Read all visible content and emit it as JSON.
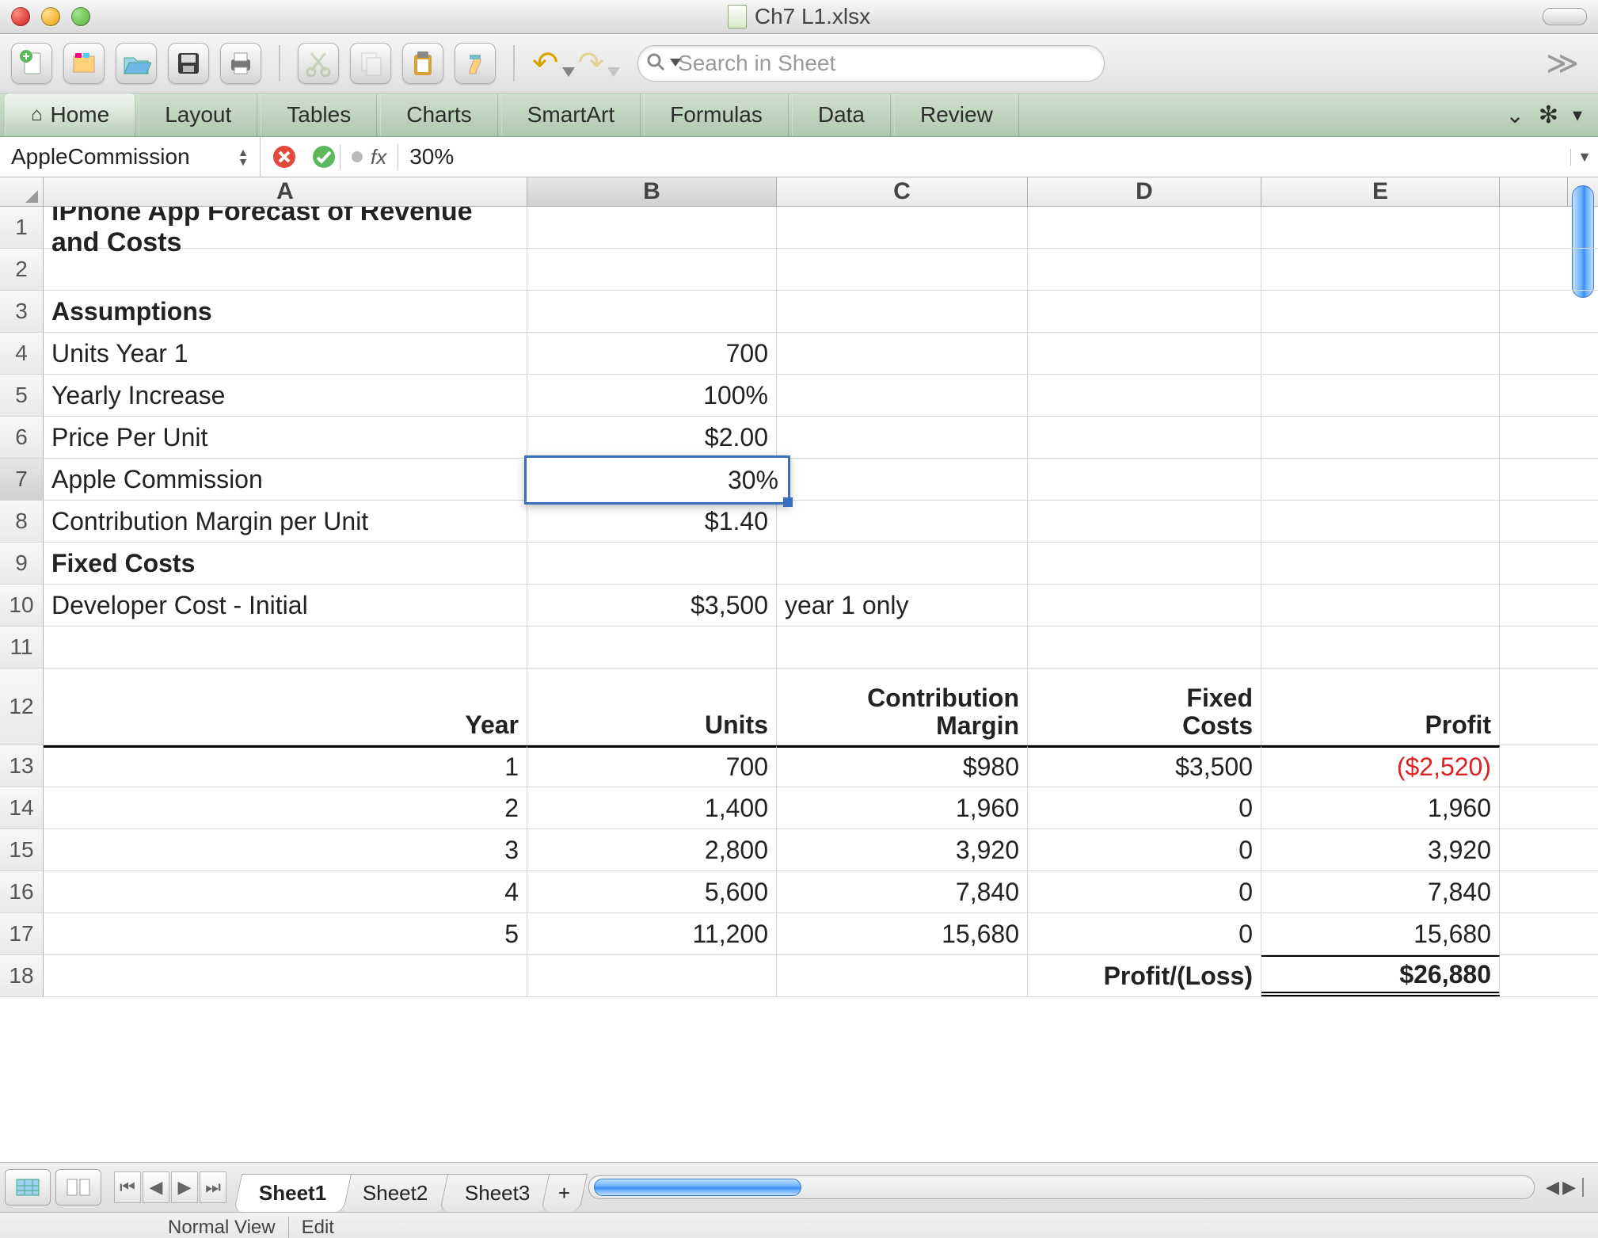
{
  "window": {
    "title": "Ch7 L1.xlsx"
  },
  "search": {
    "placeholder": "Search in Sheet"
  },
  "ribbon": {
    "tabs": [
      "Home",
      "Layout",
      "Tables",
      "Charts",
      "SmartArt",
      "Formulas",
      "Data",
      "Review"
    ],
    "active_index": 0
  },
  "formula_bar": {
    "name_box": "AppleCommission",
    "fx_label": "fx",
    "value": "30%"
  },
  "columns": [
    "A",
    "B",
    "C",
    "D",
    "E"
  ],
  "active_cell_display": "30%",
  "rows": {
    "1": {
      "A": "iPhone App Forecast of Revenue and Costs"
    },
    "2": {},
    "3": {
      "A": "Assumptions"
    },
    "4": {
      "A": "Units Year 1",
      "B": "700"
    },
    "5": {
      "A": "Yearly Increase",
      "B": "100%"
    },
    "6": {
      "A": "Price Per Unit",
      "B": "$2.00"
    },
    "7": {
      "A": "Apple Commission",
      "B": "30%"
    },
    "8": {
      "A": "Contribution Margin per Unit",
      "B": "$1.40"
    },
    "9": {
      "A": "Fixed  Costs"
    },
    "10": {
      "A": "Developer Cost - Initial",
      "B": "$3,500",
      "C": "year 1 only"
    },
    "11": {},
    "12": {
      "A": "Year",
      "B": "Units",
      "C1": "Contribution",
      "C2": "Margin",
      "D1": "Fixed",
      "D2": "Costs",
      "E": "Profit"
    },
    "13": {
      "A": "1",
      "B": "700",
      "C": "$980",
      "D": "$3,500",
      "E": "($2,520)"
    },
    "14": {
      "A": "2",
      "B": "1,400",
      "C": "1,960",
      "D": "0",
      "E": "1,960"
    },
    "15": {
      "A": "3",
      "B": "2,800",
      "C": "3,920",
      "D": "0",
      "E": "3,920"
    },
    "16": {
      "A": "4",
      "B": "5,600",
      "C": "7,840",
      "D": "0",
      "E": "7,840"
    },
    "17": {
      "A": "5",
      "B": "11,200",
      "C": "15,680",
      "D": "0",
      "E": "15,680"
    },
    "18": {
      "D": "Profit/(Loss)",
      "E": "$26,880"
    }
  },
  "sheets": {
    "tabs": [
      "Sheet1",
      "Sheet2",
      "Sheet3"
    ],
    "active_index": 0,
    "add_label": "+"
  },
  "status": {
    "left": "Normal View",
    "mode": "Edit"
  }
}
